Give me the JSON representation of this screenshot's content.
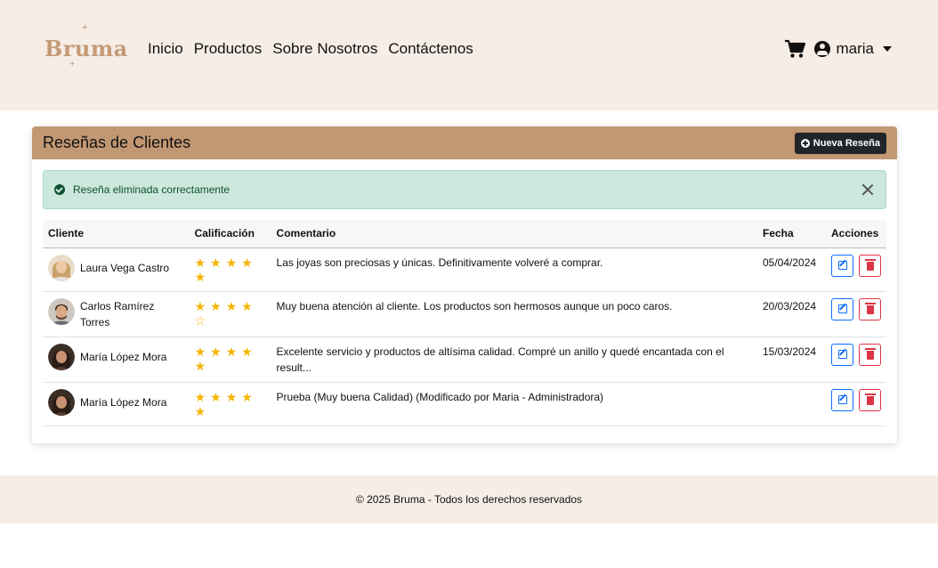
{
  "header": {
    "logo_text": "Bruma",
    "nav": [
      "Inicio",
      "Productos",
      "Sobre Nosotros",
      "Contáctenos"
    ],
    "user_name": "maria",
    "cart_icon": "cart-icon",
    "user_icon": "user-circle-icon"
  },
  "card": {
    "title": "Reseñas de Clientes",
    "new_button": "Nueva Reseña"
  },
  "alert": {
    "message": "Reseña eliminada correctamente",
    "color": "#0f5132",
    "background": "#cce8dc"
  },
  "table": {
    "headers": [
      "Cliente",
      "Calificación",
      "Comentario",
      "Fecha",
      "Acciones"
    ],
    "rows": [
      {
        "client": "Laura Vega Castro",
        "rating": 5,
        "comment": "Las joyas son preciosas y únicas. Definitivamente volveré a comprar.",
        "date": "05/04/2024"
      },
      {
        "client": "Carlos Ramírez Torres",
        "rating": 4,
        "comment": "Muy buena atención al cliente. Los productos son hermosos aunque un poco caros.",
        "date": "20/03/2024"
      },
      {
        "client": "María López Mora",
        "rating": 5,
        "comment": "Excelente servicio y productos de altísima calidad. Compré un anillo y quedé encantada con el result...",
        "date": "15/03/2024"
      },
      {
        "client": "María López Mora",
        "rating": 5,
        "comment": "Prueba (Muy buena Calidad) (Modificado por Maria - Administradora)",
        "date": ""
      }
    ]
  },
  "footer": {
    "text": "© 2025 Bruma - Todos los derechos reservados"
  },
  "colors": {
    "header_bg": "#f5ede6",
    "card_header_bg": "#c29873",
    "star": "#f5b400",
    "edit": "#0d6efd",
    "delete": "#dc3545"
  }
}
